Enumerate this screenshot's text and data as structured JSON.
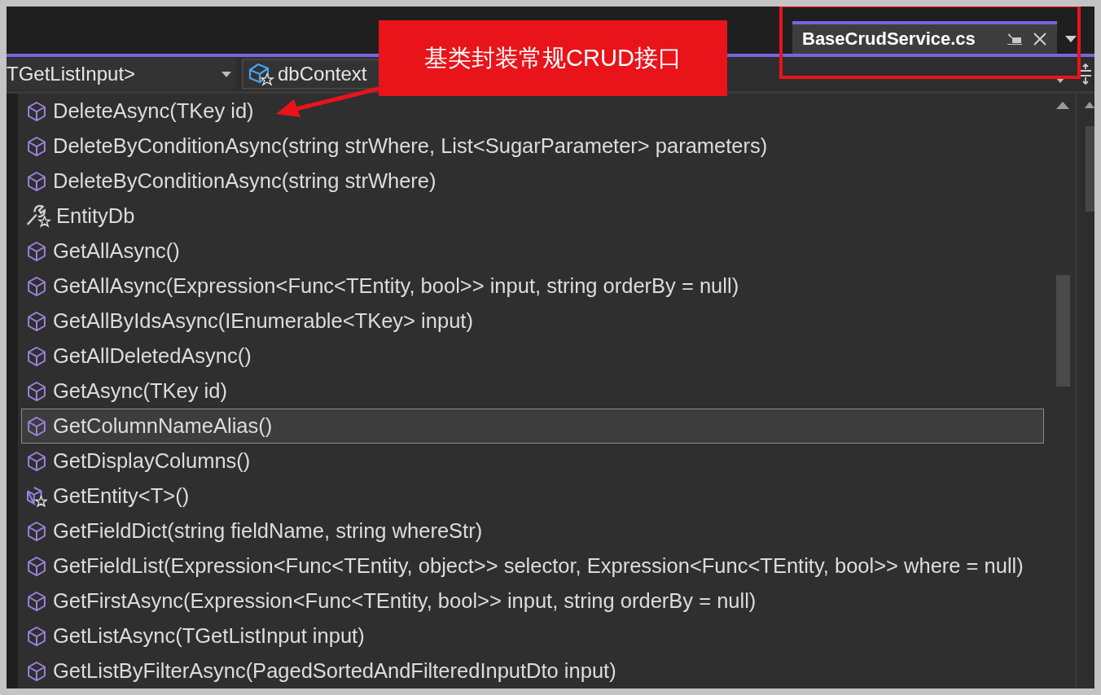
{
  "document_tab": {
    "title": "BaseCrudService.cs",
    "selected": true
  },
  "navigation_bar": {
    "type_dropdown": "TGetListInput>",
    "member_dropdown": "dbContext"
  },
  "annotation": {
    "callout": "基类封装常规CRUD接口"
  },
  "completion_list": [
    {
      "kind": "method",
      "label": "DeleteAsync(TKey id)",
      "selected": false
    },
    {
      "kind": "method",
      "label": "DeleteByConditionAsync(string strWhere, List<SugarParameter> parameters)",
      "selected": false
    },
    {
      "kind": "method",
      "label": "DeleteByConditionAsync(string strWhere)",
      "selected": false
    },
    {
      "kind": "property",
      "label": "EntityDb",
      "selected": false
    },
    {
      "kind": "method",
      "label": "GetAllAsync()",
      "selected": false
    },
    {
      "kind": "method",
      "label": "GetAllAsync(Expression<Func<TEntity, bool>> input, string orderBy = null)",
      "selected": false
    },
    {
      "kind": "method",
      "label": "GetAllByIdsAsync(IEnumerable<TKey> input)",
      "selected": false
    },
    {
      "kind": "method",
      "label": "GetAllDeletedAsync()",
      "selected": false
    },
    {
      "kind": "method",
      "label": "GetAsync(TKey id)",
      "selected": false
    },
    {
      "kind": "method",
      "label": "GetColumnNameAlias()",
      "selected": true
    },
    {
      "kind": "method",
      "label": "GetDisplayColumns()",
      "selected": false
    },
    {
      "kind": "generic",
      "label": "GetEntity<T>()",
      "selected": false
    },
    {
      "kind": "method",
      "label": "GetFieldDict(string fieldName, string whereStr)",
      "selected": false
    },
    {
      "kind": "method",
      "label": "GetFieldList(Expression<Func<TEntity, object>> selector, Expression<Func<TEntity, bool>> where = null)",
      "selected": false
    },
    {
      "kind": "method",
      "label": "GetFirstAsync(Expression<Func<TEntity, bool>> input, string orderBy = null)",
      "selected": false
    },
    {
      "kind": "method",
      "label": "GetListAsync(TGetListInput input)",
      "selected": false
    },
    {
      "kind": "method",
      "label": "GetListByFilterAsync(PagedSortedAndFilteredInputDto input)",
      "selected": false
    }
  ]
}
